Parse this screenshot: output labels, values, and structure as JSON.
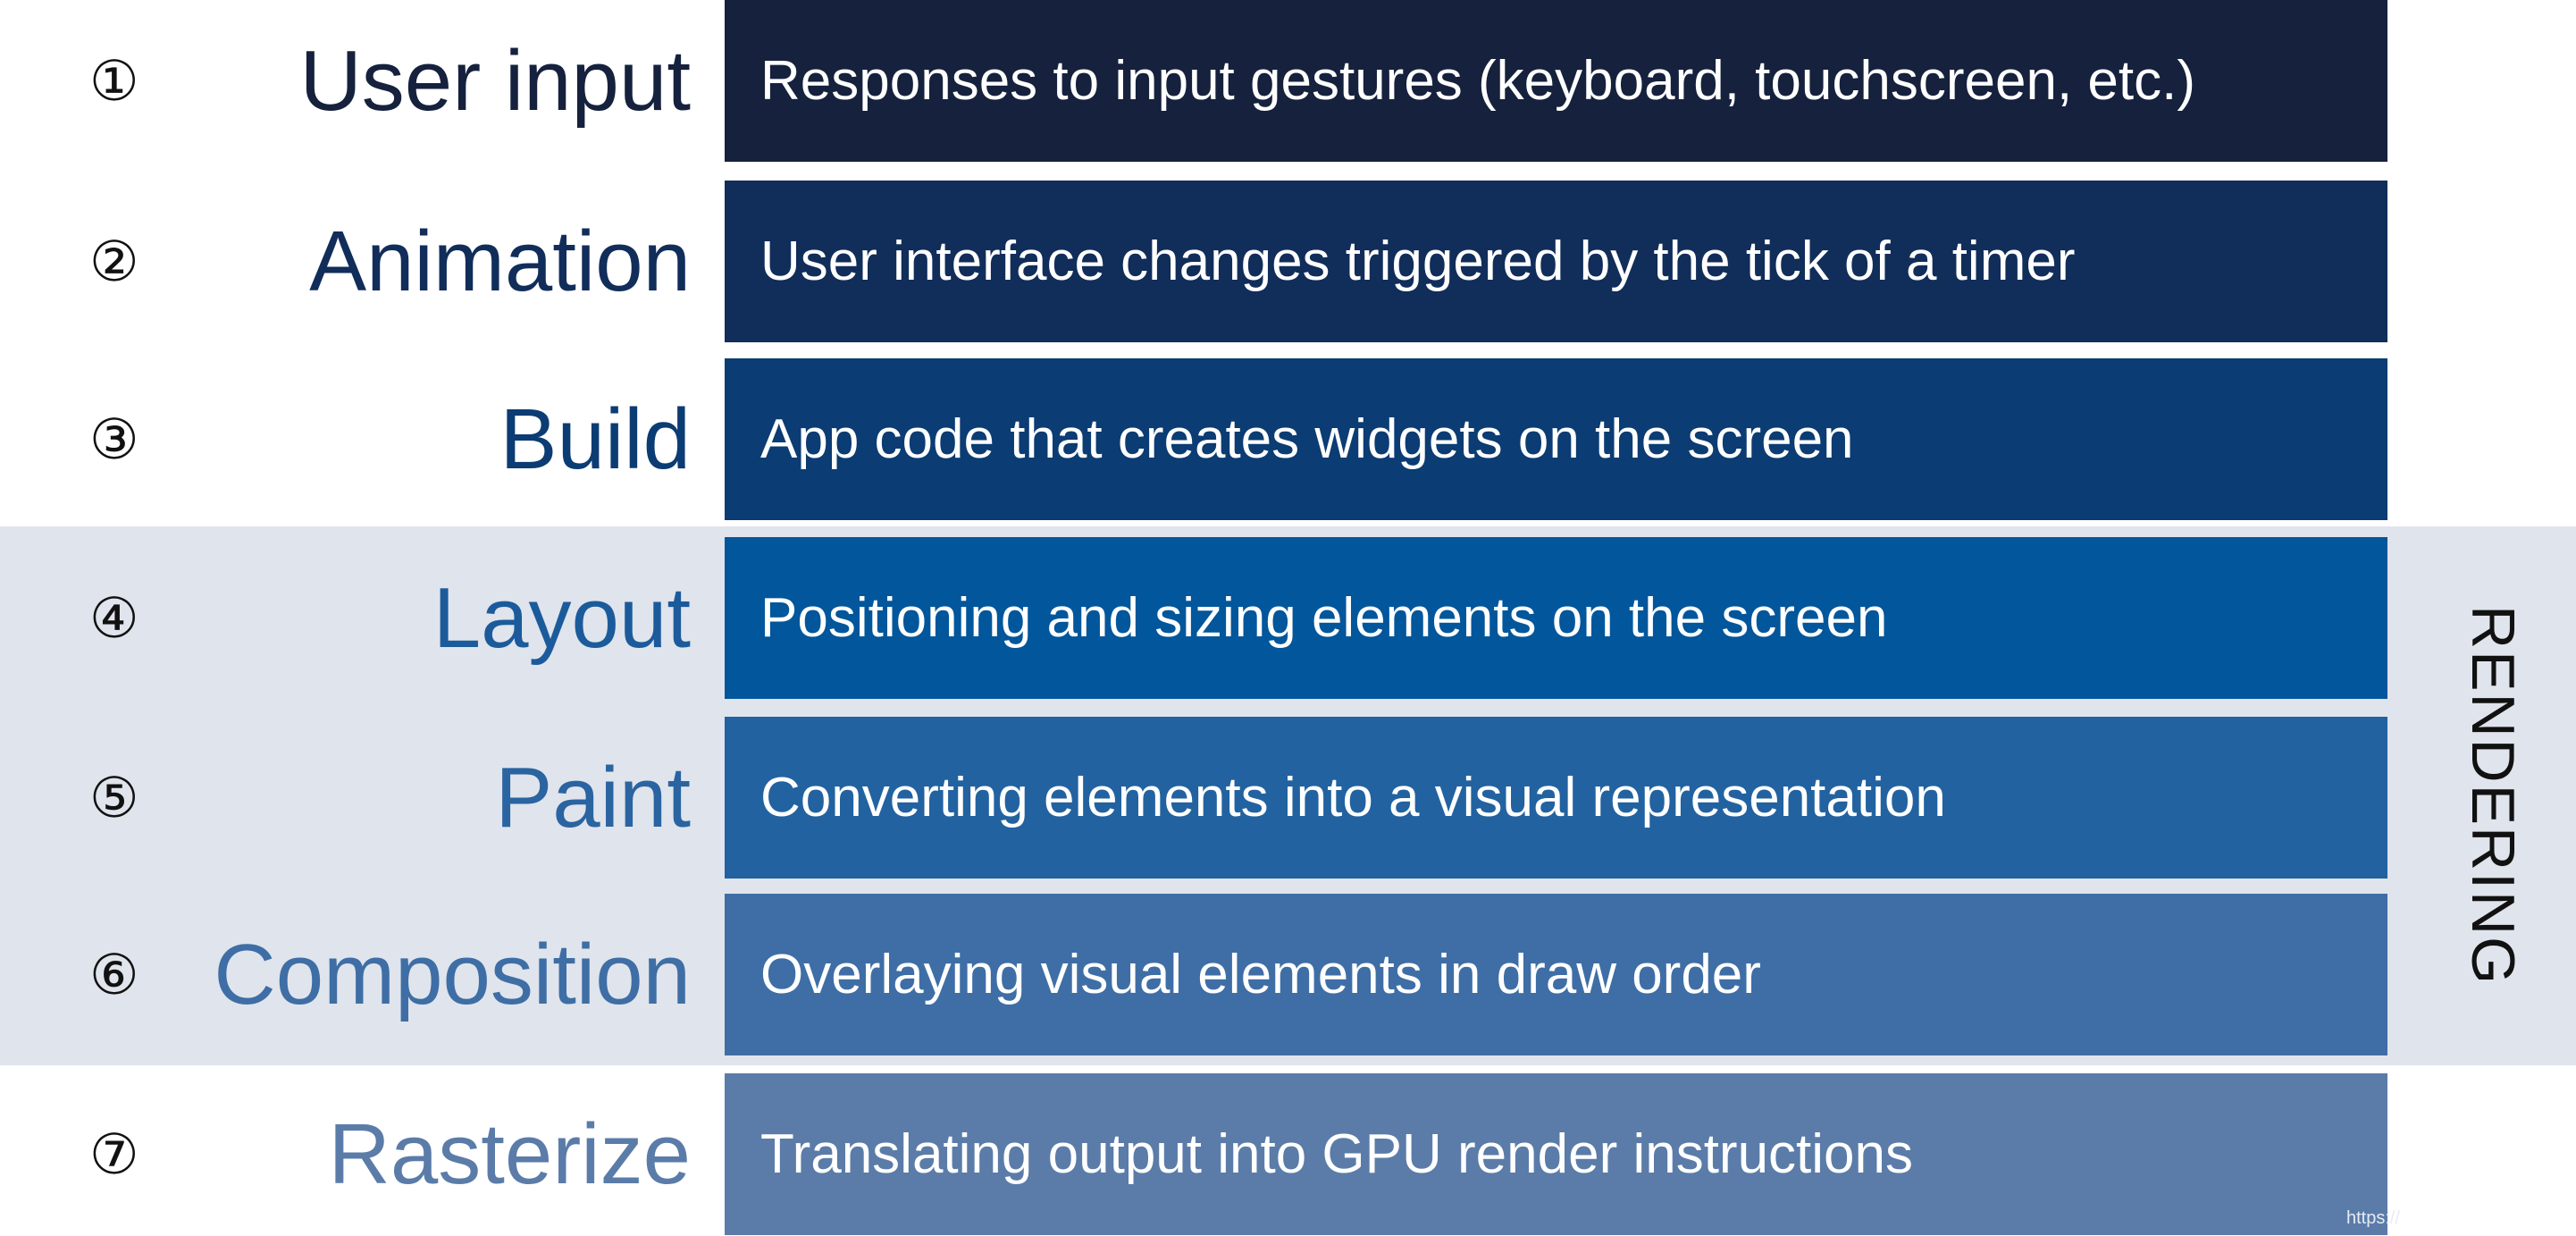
{
  "group_label": "RENDERING",
  "watermark": "https://",
  "rows": [
    {
      "number": "①",
      "name": "User input",
      "description": "Responses to input gestures (keyboard, touchscreen, etc.)",
      "bar_color": "#15213d",
      "label_color": "#15213d"
    },
    {
      "number": "②",
      "name": "Animation",
      "description": "User interface changes triggered by the tick of a timer",
      "bar_color": "#112d5a",
      "label_color": "#112d5a"
    },
    {
      "number": "③",
      "name": "Build",
      "description": "App code that creates widgets on the screen",
      "bar_color": "#0b3c73",
      "label_color": "#0b3c73"
    },
    {
      "number": "④",
      "name": "Layout",
      "description": "Positioning and sizing elements on the screen",
      "bar_color": "#02569b",
      "label_color": "#1b5b9c"
    },
    {
      "number": "⑤",
      "name": "Paint",
      "description": "Converting elements into a visual representation",
      "bar_color": "#2262a0",
      "label_color": "#2a64a1"
    },
    {
      "number": "⑥",
      "name": "Composition",
      "description": "Overlaying visual elements in draw order",
      "bar_color": "#3e6ea5",
      "label_color": "#3e6ea5"
    },
    {
      "number": "⑦",
      "name": "Rasterize",
      "description": "Translating output into GPU render instructions",
      "bar_color": "#5b7ca8",
      "label_color": "#5b7ca8"
    }
  ]
}
